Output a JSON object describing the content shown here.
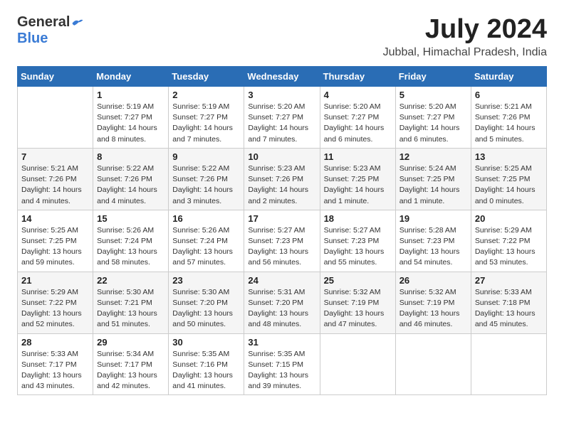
{
  "header": {
    "logo_general": "General",
    "logo_blue": "Blue",
    "month_year": "July 2024",
    "location": "Jubbal, Himachal Pradesh, India"
  },
  "weekdays": [
    "Sunday",
    "Monday",
    "Tuesday",
    "Wednesday",
    "Thursday",
    "Friday",
    "Saturday"
  ],
  "weeks": [
    [
      {
        "day": "",
        "sunrise": "",
        "sunset": "",
        "daylight": ""
      },
      {
        "day": "1",
        "sunrise": "Sunrise: 5:19 AM",
        "sunset": "Sunset: 7:27 PM",
        "daylight": "Daylight: 14 hours and 8 minutes."
      },
      {
        "day": "2",
        "sunrise": "Sunrise: 5:19 AM",
        "sunset": "Sunset: 7:27 PM",
        "daylight": "Daylight: 14 hours and 7 minutes."
      },
      {
        "day": "3",
        "sunrise": "Sunrise: 5:20 AM",
        "sunset": "Sunset: 7:27 PM",
        "daylight": "Daylight: 14 hours and 7 minutes."
      },
      {
        "day": "4",
        "sunrise": "Sunrise: 5:20 AM",
        "sunset": "Sunset: 7:27 PM",
        "daylight": "Daylight: 14 hours and 6 minutes."
      },
      {
        "day": "5",
        "sunrise": "Sunrise: 5:20 AM",
        "sunset": "Sunset: 7:27 PM",
        "daylight": "Daylight: 14 hours and 6 minutes."
      },
      {
        "day": "6",
        "sunrise": "Sunrise: 5:21 AM",
        "sunset": "Sunset: 7:26 PM",
        "daylight": "Daylight: 14 hours and 5 minutes."
      }
    ],
    [
      {
        "day": "7",
        "sunrise": "Sunrise: 5:21 AM",
        "sunset": "Sunset: 7:26 PM",
        "daylight": "Daylight: 14 hours and 4 minutes."
      },
      {
        "day": "8",
        "sunrise": "Sunrise: 5:22 AM",
        "sunset": "Sunset: 7:26 PM",
        "daylight": "Daylight: 14 hours and 4 minutes."
      },
      {
        "day": "9",
        "sunrise": "Sunrise: 5:22 AM",
        "sunset": "Sunset: 7:26 PM",
        "daylight": "Daylight: 14 hours and 3 minutes."
      },
      {
        "day": "10",
        "sunrise": "Sunrise: 5:23 AM",
        "sunset": "Sunset: 7:26 PM",
        "daylight": "Daylight: 14 hours and 2 minutes."
      },
      {
        "day": "11",
        "sunrise": "Sunrise: 5:23 AM",
        "sunset": "Sunset: 7:25 PM",
        "daylight": "Daylight: 14 hours and 1 minute."
      },
      {
        "day": "12",
        "sunrise": "Sunrise: 5:24 AM",
        "sunset": "Sunset: 7:25 PM",
        "daylight": "Daylight: 14 hours and 1 minute."
      },
      {
        "day": "13",
        "sunrise": "Sunrise: 5:25 AM",
        "sunset": "Sunset: 7:25 PM",
        "daylight": "Daylight: 14 hours and 0 minutes."
      }
    ],
    [
      {
        "day": "14",
        "sunrise": "Sunrise: 5:25 AM",
        "sunset": "Sunset: 7:25 PM",
        "daylight": "Daylight: 13 hours and 59 minutes."
      },
      {
        "day": "15",
        "sunrise": "Sunrise: 5:26 AM",
        "sunset": "Sunset: 7:24 PM",
        "daylight": "Daylight: 13 hours and 58 minutes."
      },
      {
        "day": "16",
        "sunrise": "Sunrise: 5:26 AM",
        "sunset": "Sunset: 7:24 PM",
        "daylight": "Daylight: 13 hours and 57 minutes."
      },
      {
        "day": "17",
        "sunrise": "Sunrise: 5:27 AM",
        "sunset": "Sunset: 7:23 PM",
        "daylight": "Daylight: 13 hours and 56 minutes."
      },
      {
        "day": "18",
        "sunrise": "Sunrise: 5:27 AM",
        "sunset": "Sunset: 7:23 PM",
        "daylight": "Daylight: 13 hours and 55 minutes."
      },
      {
        "day": "19",
        "sunrise": "Sunrise: 5:28 AM",
        "sunset": "Sunset: 7:23 PM",
        "daylight": "Daylight: 13 hours and 54 minutes."
      },
      {
        "day": "20",
        "sunrise": "Sunrise: 5:29 AM",
        "sunset": "Sunset: 7:22 PM",
        "daylight": "Daylight: 13 hours and 53 minutes."
      }
    ],
    [
      {
        "day": "21",
        "sunrise": "Sunrise: 5:29 AM",
        "sunset": "Sunset: 7:22 PM",
        "daylight": "Daylight: 13 hours and 52 minutes."
      },
      {
        "day": "22",
        "sunrise": "Sunrise: 5:30 AM",
        "sunset": "Sunset: 7:21 PM",
        "daylight": "Daylight: 13 hours and 51 minutes."
      },
      {
        "day": "23",
        "sunrise": "Sunrise: 5:30 AM",
        "sunset": "Sunset: 7:20 PM",
        "daylight": "Daylight: 13 hours and 50 minutes."
      },
      {
        "day": "24",
        "sunrise": "Sunrise: 5:31 AM",
        "sunset": "Sunset: 7:20 PM",
        "daylight": "Daylight: 13 hours and 48 minutes."
      },
      {
        "day": "25",
        "sunrise": "Sunrise: 5:32 AM",
        "sunset": "Sunset: 7:19 PM",
        "daylight": "Daylight: 13 hours and 47 minutes."
      },
      {
        "day": "26",
        "sunrise": "Sunrise: 5:32 AM",
        "sunset": "Sunset: 7:19 PM",
        "daylight": "Daylight: 13 hours and 46 minutes."
      },
      {
        "day": "27",
        "sunrise": "Sunrise: 5:33 AM",
        "sunset": "Sunset: 7:18 PM",
        "daylight": "Daylight: 13 hours and 45 minutes."
      }
    ],
    [
      {
        "day": "28",
        "sunrise": "Sunrise: 5:33 AM",
        "sunset": "Sunset: 7:17 PM",
        "daylight": "Daylight: 13 hours and 43 minutes."
      },
      {
        "day": "29",
        "sunrise": "Sunrise: 5:34 AM",
        "sunset": "Sunset: 7:17 PM",
        "daylight": "Daylight: 13 hours and 42 minutes."
      },
      {
        "day": "30",
        "sunrise": "Sunrise: 5:35 AM",
        "sunset": "Sunset: 7:16 PM",
        "daylight": "Daylight: 13 hours and 41 minutes."
      },
      {
        "day": "31",
        "sunrise": "Sunrise: 5:35 AM",
        "sunset": "Sunset: 7:15 PM",
        "daylight": "Daylight: 13 hours and 39 minutes."
      },
      {
        "day": "",
        "sunrise": "",
        "sunset": "",
        "daylight": ""
      },
      {
        "day": "",
        "sunrise": "",
        "sunset": "",
        "daylight": ""
      },
      {
        "day": "",
        "sunrise": "",
        "sunset": "",
        "daylight": ""
      }
    ]
  ]
}
